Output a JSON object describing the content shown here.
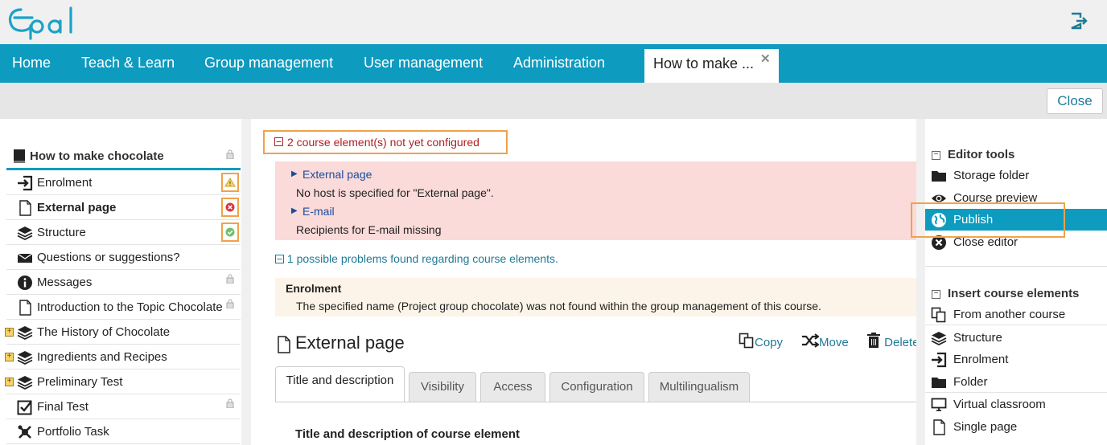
{
  "app": {
    "logo_text": "Opal"
  },
  "nav": {
    "items": [
      "Home",
      "Teach & Learn",
      "Group management",
      "User management",
      "Administration"
    ],
    "active_tab": "How to make ..."
  },
  "toolbar": {
    "close_label": "Close"
  },
  "tree": {
    "title": "How to make chocolate",
    "items": [
      {
        "label": "Enrolment",
        "icon": "enrolment-icon",
        "status": "warning"
      },
      {
        "label": "External page",
        "icon": "page-icon",
        "status": "error",
        "bold": true
      },
      {
        "label": "Structure",
        "icon": "structure-icon",
        "status": "ok"
      },
      {
        "label": "Questions or suggestions?",
        "icon": "mail-icon"
      },
      {
        "label": "Messages",
        "icon": "info-icon",
        "locked": true
      },
      {
        "label": "Introduction to the Topic Chocolate",
        "icon": "page-icon",
        "locked": true
      },
      {
        "label": "The History of Chocolate",
        "icon": "structure-icon",
        "expandable": true
      },
      {
        "label": "Ingredients and Recipes",
        "icon": "structure-icon",
        "expandable": true
      },
      {
        "label": "Preliminary Test",
        "icon": "structure-icon",
        "expandable": true
      },
      {
        "label": "Final Test",
        "icon": "checkbox-icon",
        "locked": true
      },
      {
        "label": "Portfolio Task",
        "icon": "portfolio-icon"
      }
    ]
  },
  "main": {
    "not_configured": "2 course element(s) not yet configured",
    "errors": [
      {
        "link": "External page",
        "message": "No host is specified for \"External page\"."
      },
      {
        "link": "E-mail",
        "message": "Recipients for E-mail missing"
      }
    ],
    "problems": "1 possible problems found regarding course elements.",
    "problem": {
      "title": "Enrolment",
      "text": "The specified name (Project group chocolate) was not found within the group management of this course."
    },
    "element_title": "External page",
    "actions": {
      "copy": "Copy",
      "move": "Move",
      "delete": "Delete"
    },
    "tabs": [
      "Title and description",
      "Visibility",
      "Access",
      "Configuration",
      "Multilingualism"
    ],
    "section_heading": "Title and description of course element"
  },
  "right_panel": {
    "editor_tools_heading": "Editor tools",
    "editor_tools": [
      "Storage folder",
      "Course preview",
      "Publish",
      "Close editor"
    ],
    "insert_heading": "Insert course elements",
    "insert_items": [
      "From another course",
      "Structure",
      "Enrolment",
      "Folder",
      "Virtual classroom",
      "Single page"
    ]
  },
  "colors": {
    "accent": "#0d9bbf",
    "highlight": "#f0a24a",
    "error_bg": "#fbdada",
    "warning_bg": "#fcf4e8"
  }
}
